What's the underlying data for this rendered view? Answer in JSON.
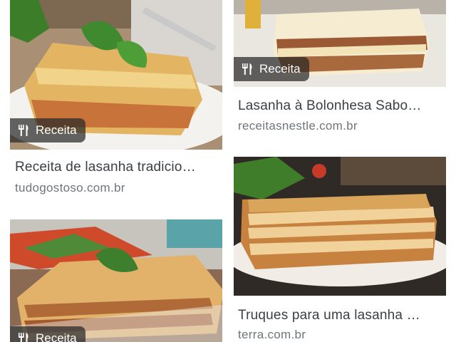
{
  "results": [
    {
      "badge": "Receita",
      "title": "Receita de lasanha tradicio…",
      "site": "tudogostoso.com.br"
    },
    {
      "badge": "Receita",
      "title": "Lasanha à Bolonhesa Sabo…",
      "site": "receitasnestle.com.br"
    },
    {
      "badge": "Receita",
      "title": "",
      "site": ""
    },
    {
      "badge": "",
      "title": "Truques para uma lasanha …",
      "site": "terra.com.br"
    }
  ],
  "icons": {
    "recipe": "fork-knife-icon"
  },
  "colors": {
    "badge_bg": "#282828",
    "title": "#3c4043",
    "site": "#70757a"
  }
}
